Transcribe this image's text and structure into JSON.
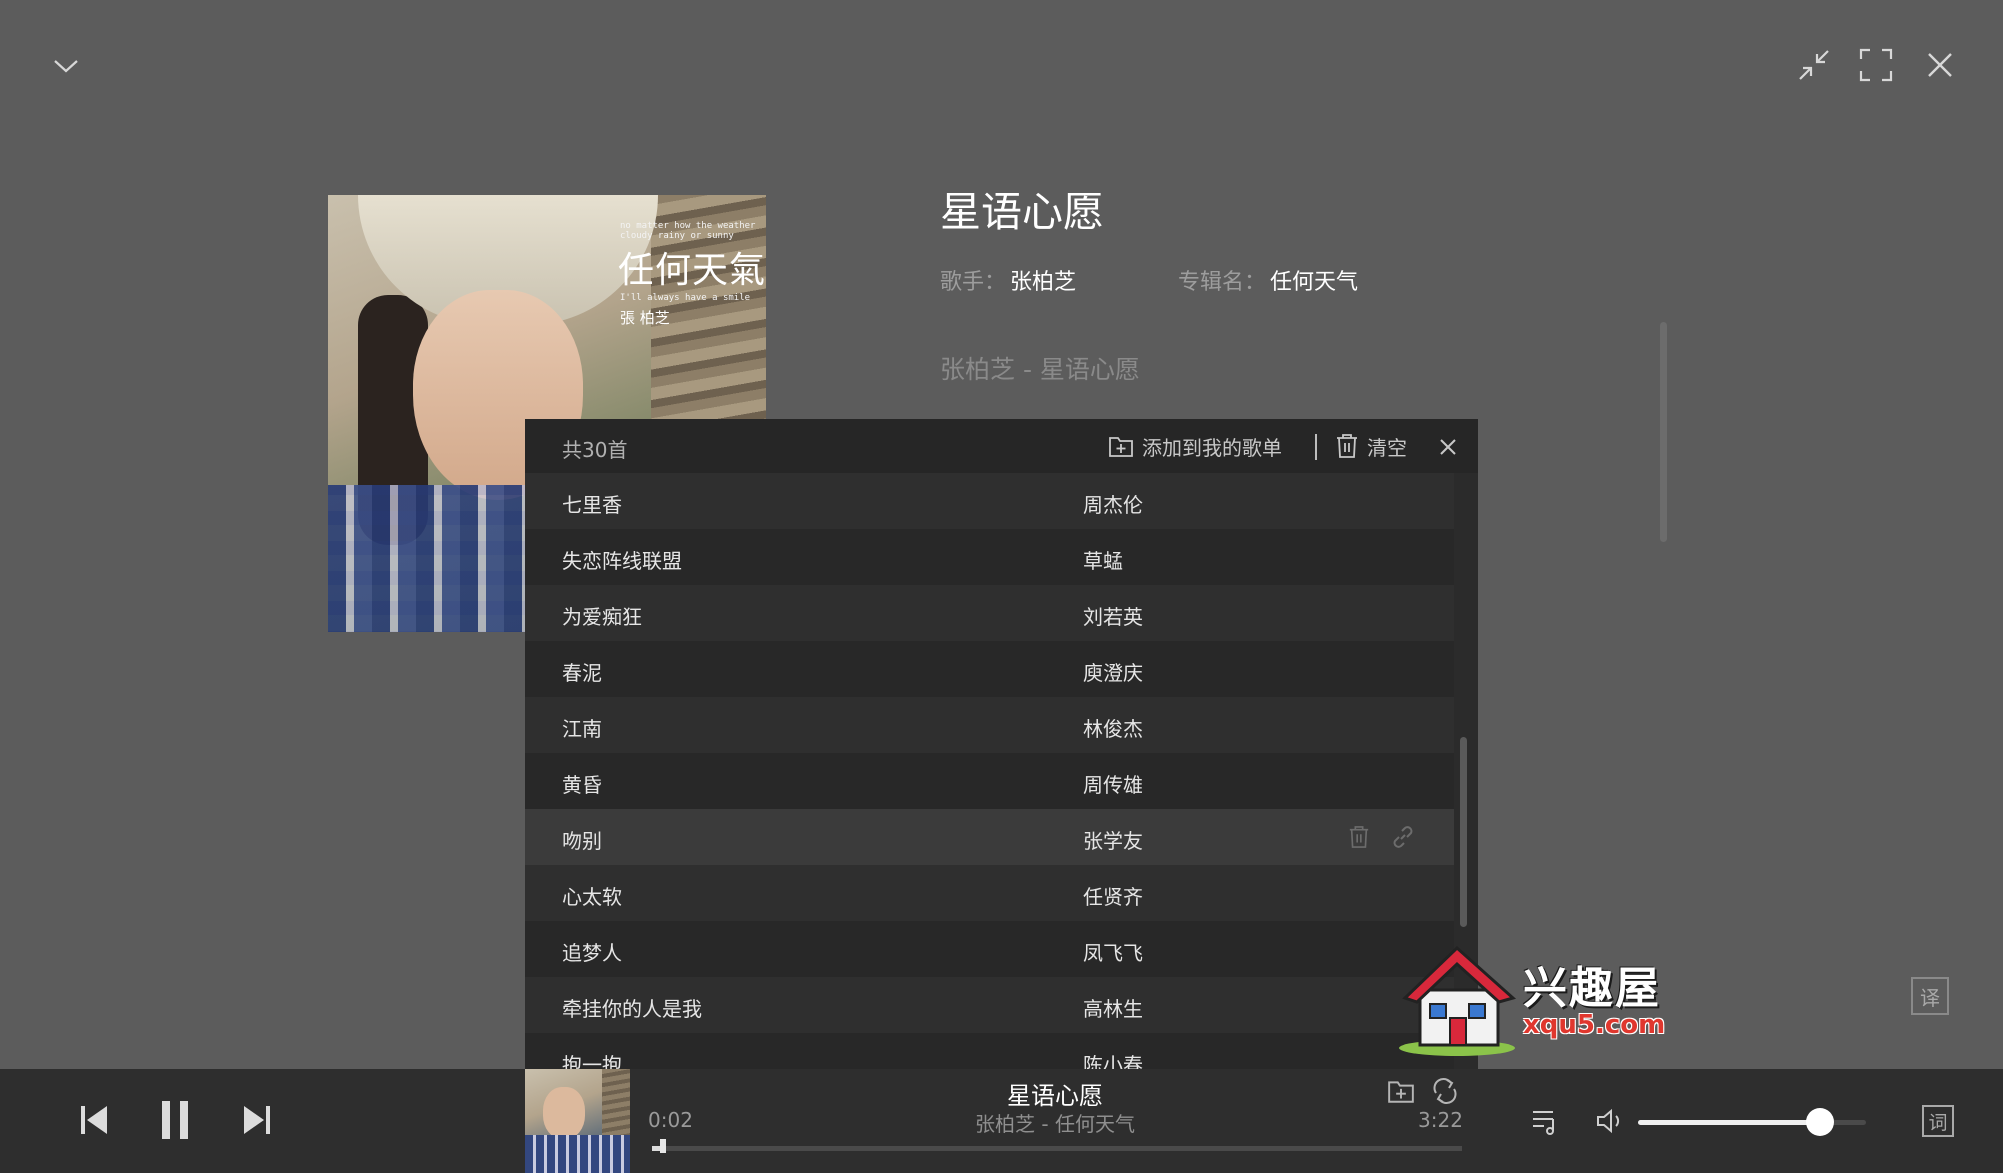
{
  "window": {
    "collapse_icon": "chevron-down-icon",
    "mini_icon": "shrink-icon",
    "fullscreen_icon": "fullscreen-icon",
    "close_icon": "close-icon"
  },
  "album_cover": {
    "title_text": "任何天氣",
    "artist_text": "張 柏芝",
    "tagline": "no matter how the weather cloudy rainy or sunny",
    "subline": "I'll always have a smile"
  },
  "song": {
    "title": "星语心愿",
    "artist_label": "歌手：",
    "artist": "张柏芝",
    "album_label": "专辑名：",
    "album": "任何天气",
    "lyric_line": "张柏芝 - 星语心愿"
  },
  "playlist": {
    "count_label": "共30首",
    "add_label": "添加到我的歌单",
    "clear_label": "清空",
    "rows": [
      {
        "name": "七里香",
        "artist": "周杰伦"
      },
      {
        "name": "失恋阵线联盟",
        "artist": "草蜢"
      },
      {
        "name": "为爱痴狂",
        "artist": "刘若英"
      },
      {
        "name": "春泥",
        "artist": "庾澄庆"
      },
      {
        "name": "江南",
        "artist": "林俊杰"
      },
      {
        "name": "黄昏",
        "artist": "周传雄"
      },
      {
        "name": "吻别",
        "artist": "张学友"
      },
      {
        "name": "心太软",
        "artist": "任贤齐"
      },
      {
        "name": "追梦人",
        "artist": "凤飞飞"
      },
      {
        "name": "牵挂你的人是我",
        "artist": "高林生"
      },
      {
        "name": "抱一抱",
        "artist": "陈小春"
      }
    ],
    "hover_row": 6
  },
  "player": {
    "title": "星语心愿",
    "subtitle": "张柏芝 - 任何天气",
    "current_time": "0:02",
    "total_time": "3:22",
    "progress": 0.01,
    "volume": 0.8,
    "translate_label": "译",
    "lyric_label": "词"
  },
  "watermark": {
    "text1": "兴趣屋",
    "text2": "xqu5.com"
  }
}
